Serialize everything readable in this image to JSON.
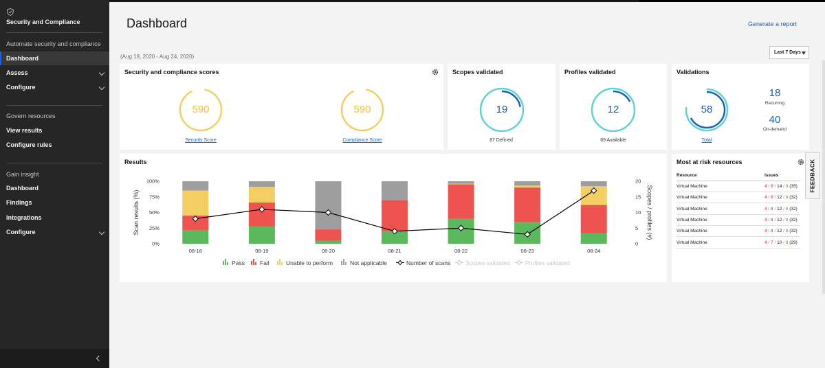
{
  "sidebar": {
    "title": "Security and Compliance",
    "section1": "Automate security and compliance",
    "items1": [
      {
        "label": "Dashboard",
        "active": true
      },
      {
        "label": "Assess",
        "chevron": true
      },
      {
        "label": "Configure",
        "chevron": true
      }
    ],
    "section2": "Govern resources",
    "items2": [
      {
        "label": "View results"
      },
      {
        "label": "Configure rules"
      }
    ],
    "section3": "Gain insight",
    "items3": [
      {
        "label": "Dashboard"
      },
      {
        "label": "Findings"
      },
      {
        "label": "Integrations"
      },
      {
        "label": "Configure",
        "chevron": true
      }
    ]
  },
  "header": {
    "title": "Dashboard",
    "report_link": "Generate a report",
    "date_range": "(Aug 18, 2020 - Aug 24, 2020)",
    "period": "Last 7 Days"
  },
  "scores": {
    "title": "Security and compliance scores",
    "security_value": "590",
    "security_label": "Security Score",
    "compliance_value": "590",
    "compliance_label": "Compliance Score"
  },
  "scopes": {
    "title": "Scopes validated",
    "value": "19",
    "sub": "87 Defined"
  },
  "profiles": {
    "title": "Profiles validated",
    "value": "12",
    "sub": "69 Available"
  },
  "validations": {
    "title": "Validations",
    "total": "58",
    "total_label": "Total",
    "recurring": "18",
    "recurring_label": "Recurring",
    "ondemand": "40",
    "ondemand_label": "On-demand"
  },
  "results": {
    "title": "Results"
  },
  "risk": {
    "title": "Most at risk resources",
    "col_resource": "Resource",
    "col_issues": "Issues",
    "rows": [
      {
        "resource": "Virtual Machine",
        "a": "4",
        "b": "8",
        "c": "14",
        "d": "9",
        "total": "(35)"
      },
      {
        "resource": "Virtual Machine",
        "a": "4",
        "b": "8",
        "c": "12",
        "d": "8",
        "total": "(32)"
      },
      {
        "resource": "Virtual Machine",
        "a": "4",
        "b": "8",
        "c": "12",
        "d": "8",
        "total": "(32)"
      },
      {
        "resource": "Virtual Machine",
        "a": "4",
        "b": "8",
        "c": "12",
        "d": "8",
        "total": "(32)"
      },
      {
        "resource": "Virtual Machine",
        "a": "4",
        "b": "8",
        "c": "12",
        "d": "8",
        "total": "(32)"
      },
      {
        "resource": "Virtual Machine",
        "a": "4",
        "b": "7",
        "c": "10",
        "d": "8",
        "total": "(29)"
      }
    ]
  },
  "feedback": "FEEDBACK",
  "colors": {
    "pass": "#5cb85c",
    "fail": "#ee5350",
    "unable": "#f3cf63",
    "na": "#9e9e9e",
    "ring_yellow": "#f3cf63",
    "ring_teal": "#5fd3d3",
    "ring_blue": "#1f5fb8"
  },
  "chart_data": {
    "type": "bar",
    "title": "",
    "xlabel": "",
    "ylabel": "Scan results (%)",
    "y2label": "Scopes / profiles (#)",
    "ylim": [
      0,
      100
    ],
    "y2lim": [
      0,
      20
    ],
    "yticks": [
      "0%",
      "25%",
      "50%",
      "75%",
      "100%"
    ],
    "y2ticks": [
      "0",
      "5",
      "10",
      "15",
      "20"
    ],
    "categories": [
      "08-18",
      "08-19",
      "08-20",
      "08-21",
      "08-22",
      "08-23",
      "08-24"
    ],
    "series": [
      {
        "name": "Pass",
        "values": [
          22,
          28,
          5,
          20,
          40,
          35,
          17
        ]
      },
      {
        "name": "Fail",
        "values": [
          23,
          38,
          18,
          50,
          55,
          55,
          45
        ]
      },
      {
        "name": "Unable to perform",
        "values": [
          40,
          25,
          0,
          0,
          1,
          3,
          30
        ]
      },
      {
        "name": "Not applicable",
        "values": [
          15,
          9,
          77,
          30,
          4,
          7,
          8
        ]
      }
    ],
    "line": {
      "name": "Number of scans",
      "values": [
        8,
        11,
        10,
        4,
        5,
        3,
        17
      ]
    },
    "legend": [
      "Pass",
      "Fail",
      "Unable to perform",
      "Not applicable",
      "Number of scans",
      "Scopes validated",
      "Profiles validated"
    ],
    "legend_position": "bottom"
  }
}
